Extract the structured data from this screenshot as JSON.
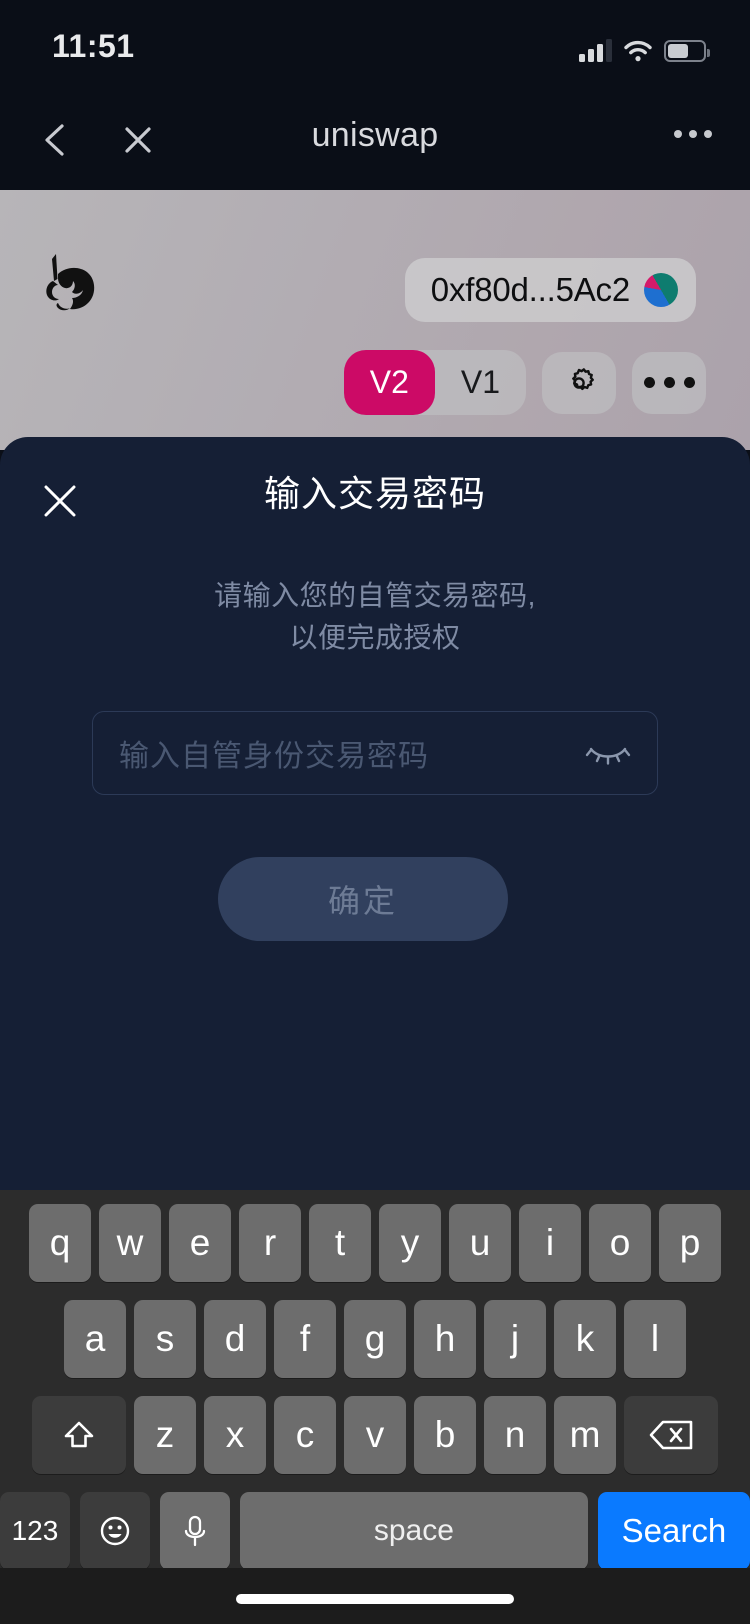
{
  "status_bar": {
    "time": "11:51",
    "signal_icon": "cellular-signal-icon",
    "wifi_icon": "wifi-icon",
    "battery_icon": "battery-icon"
  },
  "browser_nav": {
    "back_icon": "chevron-left-icon",
    "close_icon": "close-icon",
    "title": "uniswap",
    "more_icon": "more-horizontal-icon"
  },
  "webpage": {
    "logo_icon": "uniswap-unicorn-logo-icon",
    "account": {
      "address": "0xf80d...5Ac2",
      "avatar_icon": "wallet-avatar-icon"
    },
    "versions": [
      {
        "label": "V2",
        "active": true
      },
      {
        "label": "V1",
        "active": false
      }
    ],
    "settings_icon": "gear-icon",
    "menu_icon": "more-horizontal-icon",
    "accent_color": "#cc0a66"
  },
  "modal": {
    "close_icon": "close-icon",
    "title": "输入交易密码",
    "description_line1": "请输入您的自管交易密码,",
    "description_line2": "以便完成授权",
    "password_input": {
      "placeholder": "输入自管身份交易密码",
      "value": "",
      "toggle_icon": "eye-off-icon"
    },
    "confirm_label": "确定",
    "background_color": "#151f35"
  },
  "keyboard": {
    "row1": [
      "q",
      "w",
      "e",
      "r",
      "t",
      "y",
      "u",
      "i",
      "o",
      "p"
    ],
    "row2": [
      "a",
      "s",
      "d",
      "f",
      "g",
      "h",
      "j",
      "k",
      "l"
    ],
    "row3": [
      "z",
      "x",
      "c",
      "v",
      "b",
      "n",
      "m"
    ],
    "shift_icon": "shift-icon",
    "backspace_icon": "backspace-icon",
    "numbers_label": "123",
    "emoji_icon": "emoji-icon",
    "mic_icon": "microphone-icon",
    "space_label": "space",
    "return_label": "Search",
    "return_color": "#0a7aff",
    "home_indicator": "home-indicator"
  }
}
